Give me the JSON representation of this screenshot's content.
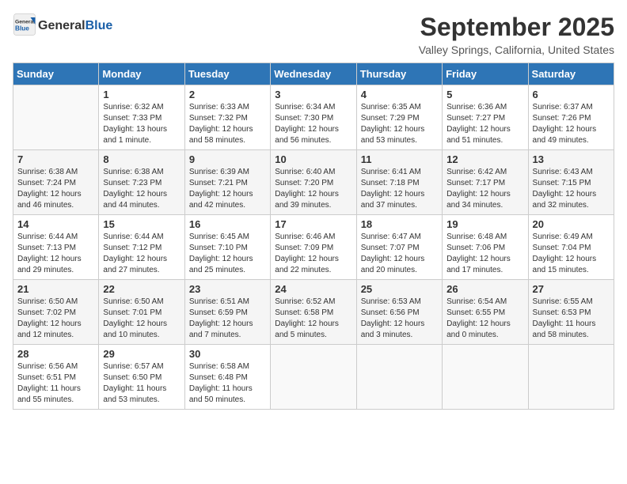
{
  "logo": {
    "general": "General",
    "blue": "Blue"
  },
  "title": "September 2025",
  "location": "Valley Springs, California, United States",
  "weekdays": [
    "Sunday",
    "Monday",
    "Tuesday",
    "Wednesday",
    "Thursday",
    "Friday",
    "Saturday"
  ],
  "weeks": [
    [
      {
        "day": "",
        "sunrise": "",
        "sunset": "",
        "daylight": ""
      },
      {
        "day": "1",
        "sunrise": "Sunrise: 6:32 AM",
        "sunset": "Sunset: 7:33 PM",
        "daylight": "Daylight: 13 hours and 1 minute."
      },
      {
        "day": "2",
        "sunrise": "Sunrise: 6:33 AM",
        "sunset": "Sunset: 7:32 PM",
        "daylight": "Daylight: 12 hours and 58 minutes."
      },
      {
        "day": "3",
        "sunrise": "Sunrise: 6:34 AM",
        "sunset": "Sunset: 7:30 PM",
        "daylight": "Daylight: 12 hours and 56 minutes."
      },
      {
        "day": "4",
        "sunrise": "Sunrise: 6:35 AM",
        "sunset": "Sunset: 7:29 PM",
        "daylight": "Daylight: 12 hours and 53 minutes."
      },
      {
        "day": "5",
        "sunrise": "Sunrise: 6:36 AM",
        "sunset": "Sunset: 7:27 PM",
        "daylight": "Daylight: 12 hours and 51 minutes."
      },
      {
        "day": "6",
        "sunrise": "Sunrise: 6:37 AM",
        "sunset": "Sunset: 7:26 PM",
        "daylight": "Daylight: 12 hours and 49 minutes."
      }
    ],
    [
      {
        "day": "7",
        "sunrise": "Sunrise: 6:38 AM",
        "sunset": "Sunset: 7:24 PM",
        "daylight": "Daylight: 12 hours and 46 minutes."
      },
      {
        "day": "8",
        "sunrise": "Sunrise: 6:38 AM",
        "sunset": "Sunset: 7:23 PM",
        "daylight": "Daylight: 12 hours and 44 minutes."
      },
      {
        "day": "9",
        "sunrise": "Sunrise: 6:39 AM",
        "sunset": "Sunset: 7:21 PM",
        "daylight": "Daylight: 12 hours and 42 minutes."
      },
      {
        "day": "10",
        "sunrise": "Sunrise: 6:40 AM",
        "sunset": "Sunset: 7:20 PM",
        "daylight": "Daylight: 12 hours and 39 minutes."
      },
      {
        "day": "11",
        "sunrise": "Sunrise: 6:41 AM",
        "sunset": "Sunset: 7:18 PM",
        "daylight": "Daylight: 12 hours and 37 minutes."
      },
      {
        "day": "12",
        "sunrise": "Sunrise: 6:42 AM",
        "sunset": "Sunset: 7:17 PM",
        "daylight": "Daylight: 12 hours and 34 minutes."
      },
      {
        "day": "13",
        "sunrise": "Sunrise: 6:43 AM",
        "sunset": "Sunset: 7:15 PM",
        "daylight": "Daylight: 12 hours and 32 minutes."
      }
    ],
    [
      {
        "day": "14",
        "sunrise": "Sunrise: 6:44 AM",
        "sunset": "Sunset: 7:13 PM",
        "daylight": "Daylight: 12 hours and 29 minutes."
      },
      {
        "day": "15",
        "sunrise": "Sunrise: 6:44 AM",
        "sunset": "Sunset: 7:12 PM",
        "daylight": "Daylight: 12 hours and 27 minutes."
      },
      {
        "day": "16",
        "sunrise": "Sunrise: 6:45 AM",
        "sunset": "Sunset: 7:10 PM",
        "daylight": "Daylight: 12 hours and 25 minutes."
      },
      {
        "day": "17",
        "sunrise": "Sunrise: 6:46 AM",
        "sunset": "Sunset: 7:09 PM",
        "daylight": "Daylight: 12 hours and 22 minutes."
      },
      {
        "day": "18",
        "sunrise": "Sunrise: 6:47 AM",
        "sunset": "Sunset: 7:07 PM",
        "daylight": "Daylight: 12 hours and 20 minutes."
      },
      {
        "day": "19",
        "sunrise": "Sunrise: 6:48 AM",
        "sunset": "Sunset: 7:06 PM",
        "daylight": "Daylight: 12 hours and 17 minutes."
      },
      {
        "day": "20",
        "sunrise": "Sunrise: 6:49 AM",
        "sunset": "Sunset: 7:04 PM",
        "daylight": "Daylight: 12 hours and 15 minutes."
      }
    ],
    [
      {
        "day": "21",
        "sunrise": "Sunrise: 6:50 AM",
        "sunset": "Sunset: 7:02 PM",
        "daylight": "Daylight: 12 hours and 12 minutes."
      },
      {
        "day": "22",
        "sunrise": "Sunrise: 6:50 AM",
        "sunset": "Sunset: 7:01 PM",
        "daylight": "Daylight: 12 hours and 10 minutes."
      },
      {
        "day": "23",
        "sunrise": "Sunrise: 6:51 AM",
        "sunset": "Sunset: 6:59 PM",
        "daylight": "Daylight: 12 hours and 7 minutes."
      },
      {
        "day": "24",
        "sunrise": "Sunrise: 6:52 AM",
        "sunset": "Sunset: 6:58 PM",
        "daylight": "Daylight: 12 hours and 5 minutes."
      },
      {
        "day": "25",
        "sunrise": "Sunrise: 6:53 AM",
        "sunset": "Sunset: 6:56 PM",
        "daylight": "Daylight: 12 hours and 3 minutes."
      },
      {
        "day": "26",
        "sunrise": "Sunrise: 6:54 AM",
        "sunset": "Sunset: 6:55 PM",
        "daylight": "Daylight: 12 hours and 0 minutes."
      },
      {
        "day": "27",
        "sunrise": "Sunrise: 6:55 AM",
        "sunset": "Sunset: 6:53 PM",
        "daylight": "Daylight: 11 hours and 58 minutes."
      }
    ],
    [
      {
        "day": "28",
        "sunrise": "Sunrise: 6:56 AM",
        "sunset": "Sunset: 6:51 PM",
        "daylight": "Daylight: 11 hours and 55 minutes."
      },
      {
        "day": "29",
        "sunrise": "Sunrise: 6:57 AM",
        "sunset": "Sunset: 6:50 PM",
        "daylight": "Daylight: 11 hours and 53 minutes."
      },
      {
        "day": "30",
        "sunrise": "Sunrise: 6:58 AM",
        "sunset": "Sunset: 6:48 PM",
        "daylight": "Daylight: 11 hours and 50 minutes."
      },
      {
        "day": "",
        "sunrise": "",
        "sunset": "",
        "daylight": ""
      },
      {
        "day": "",
        "sunrise": "",
        "sunset": "",
        "daylight": ""
      },
      {
        "day": "",
        "sunrise": "",
        "sunset": "",
        "daylight": ""
      },
      {
        "day": "",
        "sunrise": "",
        "sunset": "",
        "daylight": ""
      }
    ]
  ]
}
